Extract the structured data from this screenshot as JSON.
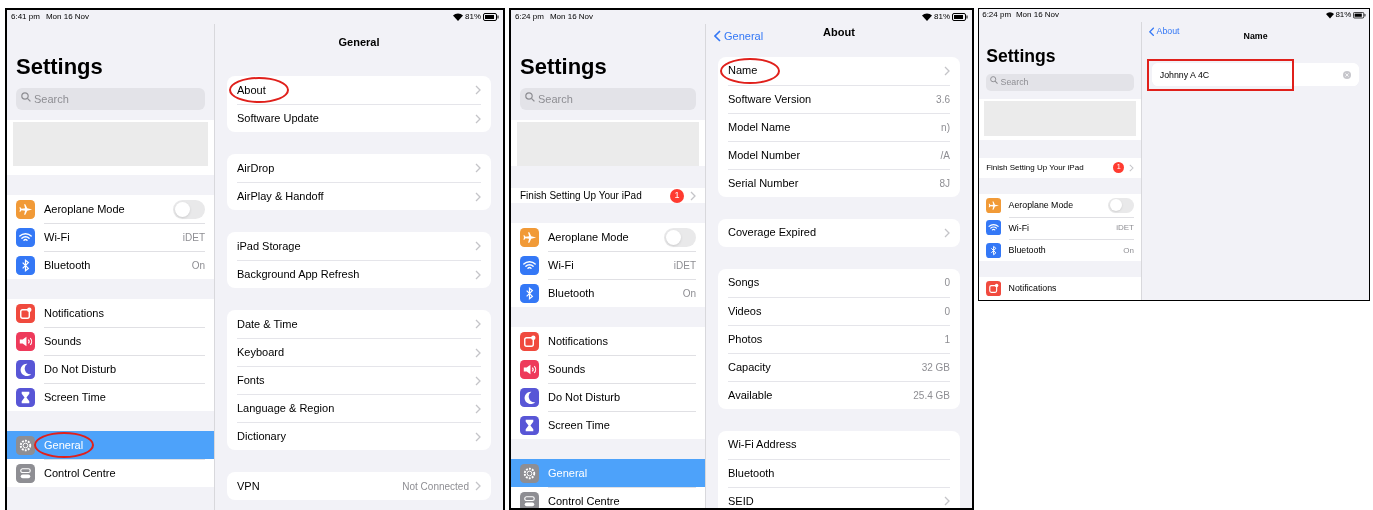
{
  "panels": [
    {
      "status_bar": {
        "time": "6:41 pm",
        "date": "Mon 16 Nov",
        "battery": "81%"
      },
      "sidebar": {
        "title": "Settings",
        "search": {
          "placeholder": "Search"
        },
        "groups": [
          [
            {
              "label": "Aeroplane Mode",
              "color": "#f19a37",
              "kind": "toggle",
              "on": false,
              "selected": false,
              "circled": false
            },
            {
              "label": "Wi-Fi",
              "color": "#3478f6",
              "kind": "nav",
              "value": "iDET",
              "selected": false,
              "circled": false
            },
            {
              "label": "Bluetooth",
              "color": "#3478f6",
              "kind": "nav",
              "value": "On",
              "selected": false,
              "circled": false
            }
          ],
          [
            {
              "label": "Notifications",
              "color": "#f04a3e",
              "kind": "nav",
              "selected": false,
              "circled": false
            },
            {
              "label": "Sounds",
              "color": "#ee3a5b",
              "kind": "nav",
              "selected": false,
              "circled": false
            },
            {
              "label": "Do Not Disturb",
              "color": "#5856d6",
              "kind": "nav",
              "selected": false,
              "circled": false
            },
            {
              "label": "Screen Time",
              "color": "#5856d6",
              "kind": "nav",
              "selected": false,
              "circled": false
            }
          ],
          [
            {
              "label": "General",
              "color": "#8e8e93",
              "kind": "nav",
              "selected": true,
              "circled": true
            },
            {
              "label": "Control Centre",
              "color": "#8e8e93",
              "kind": "nav",
              "selected": false,
              "circled": false
            }
          ]
        ]
      },
      "detail": {
        "title": "General",
        "groups": [
          [
            {
              "label": "About",
              "chevron": true,
              "circled": true
            },
            {
              "label": "Software Update",
              "chevron": true,
              "circled": false
            }
          ],
          [
            {
              "label": "AirDrop",
              "chevron": true,
              "circled": false
            },
            {
              "label": "AirPlay & Handoff",
              "chevron": true,
              "circled": false
            }
          ],
          [
            {
              "label": "iPad Storage",
              "chevron": true,
              "circled": false
            },
            {
              "label": "Background App Refresh",
              "chevron": true,
              "circled": false
            }
          ],
          [
            {
              "label": "Date & Time",
              "chevron": true,
              "circled": false
            },
            {
              "label": "Keyboard",
              "chevron": true,
              "circled": false
            },
            {
              "label": "Fonts",
              "chevron": true,
              "circled": false
            },
            {
              "label": "Language & Region",
              "chevron": true,
              "circled": false
            },
            {
              "label": "Dictionary",
              "chevron": true,
              "circled": false
            }
          ],
          [
            {
              "label": "VPN",
              "value": "Not Connected",
              "chevron": true,
              "circled": false
            }
          ]
        ]
      }
    },
    {
      "status_bar": {
        "time": "6:24 pm",
        "date": "Mon 16 Nov",
        "battery": "81%"
      },
      "sidebar": {
        "title": "Settings",
        "search": {
          "placeholder": "Search"
        },
        "promo": {
          "label": "Finish Setting Up Your iPad",
          "badge": "1"
        },
        "groups": [
          [
            {
              "label": "Aeroplane Mode",
              "color": "#f19a37",
              "kind": "toggle",
              "on": false,
              "selected": false,
              "circled": false
            },
            {
              "label": "Wi-Fi",
              "color": "#3478f6",
              "kind": "nav",
              "value": "iDET",
              "selected": false,
              "circled": false
            },
            {
              "label": "Bluetooth",
              "color": "#3478f6",
              "kind": "nav",
              "value": "On",
              "selected": false,
              "circled": false
            }
          ],
          [
            {
              "label": "Notifications",
              "color": "#f04a3e",
              "kind": "nav",
              "selected": false,
              "circled": false
            },
            {
              "label": "Sounds",
              "color": "#ee3a5b",
              "kind": "nav",
              "selected": false,
              "circled": false
            },
            {
              "label": "Do Not Disturb",
              "color": "#5856d6",
              "kind": "nav",
              "selected": false,
              "circled": false
            },
            {
              "label": "Screen Time",
              "color": "#5856d6",
              "kind": "nav",
              "selected": false,
              "circled": false
            }
          ],
          [
            {
              "label": "General",
              "color": "#8e8e93",
              "kind": "nav",
              "selected": true,
              "circled": false
            },
            {
              "label": "Control Centre",
              "color": "#8e8e93",
              "kind": "nav",
              "selected": false,
              "circled": false
            }
          ]
        ]
      },
      "detail": {
        "back": "General",
        "title": "About",
        "groups": [
          [
            {
              "label": "Name",
              "chevron": true,
              "circled": true
            },
            {
              "label": "Software Version",
              "value": "3.6",
              "chevron": false,
              "circled": false
            },
            {
              "label": "Model Name",
              "value": "n)",
              "chevron": false,
              "circled": false
            },
            {
              "label": "Model Number",
              "value": "/A",
              "chevron": false,
              "circled": false
            },
            {
              "label": "Serial Number",
              "value": "8J",
              "chevron": false,
              "circled": false
            }
          ],
          [
            {
              "label": "Coverage Expired",
              "chevron": true,
              "circled": false
            }
          ],
          [
            {
              "label": "Songs",
              "value": "0",
              "chevron": false,
              "circled": false
            },
            {
              "label": "Videos",
              "value": "0",
              "chevron": false,
              "circled": false
            },
            {
              "label": "Photos",
              "value": "1",
              "chevron": false,
              "circled": false
            },
            {
              "label": "Capacity",
              "value": "32 GB",
              "chevron": false,
              "circled": false
            },
            {
              "label": "Available",
              "value": "25.4 GB",
              "chevron": false,
              "circled": false
            }
          ],
          [
            {
              "label": "Wi-Fi Address",
              "chevron": false,
              "circled": false
            },
            {
              "label": "Bluetooth",
              "chevron": false,
              "circled": false
            },
            {
              "label": "SEID",
              "chevron": true,
              "circled": false
            }
          ]
        ]
      }
    },
    {
      "status_bar": {
        "time": "6:24 pm",
        "date": "Mon 16 Nov",
        "battery": "81%"
      },
      "sidebar": {
        "title": "Settings",
        "search": {
          "placeholder": "Search"
        },
        "promo": {
          "label": "Finish Setting Up Your iPad",
          "badge": "1"
        },
        "groups": [
          [
            {
              "label": "Aeroplane Mode",
              "color": "#f19a37",
              "kind": "toggle",
              "on": false,
              "selected": false,
              "circled": false
            },
            {
              "label": "Wi-Fi",
              "color": "#3478f6",
              "kind": "nav",
              "value": "iDET",
              "selected": false,
              "circled": false
            },
            {
              "label": "Bluetooth",
              "color": "#3478f6",
              "kind": "nav",
              "value": "On",
              "selected": false,
              "circled": false
            }
          ],
          [
            {
              "label": "Notifications",
              "color": "#f04a3e",
              "kind": "nav",
              "selected": false,
              "circled": false
            }
          ]
        ]
      },
      "detail": {
        "back": "About",
        "title": "Name",
        "groups": [
          [
            {
              "kind": "field",
              "value": "Johnny A 4C",
              "boxed": true
            }
          ]
        ]
      }
    }
  ]
}
